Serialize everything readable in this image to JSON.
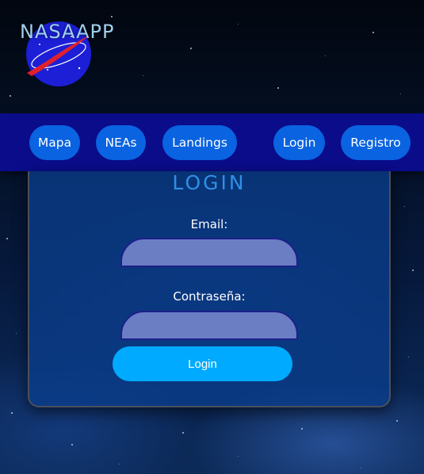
{
  "header": {
    "brand": "NASAAPP",
    "logo_icon": "nasa-meatball-logo"
  },
  "nav": {
    "items": [
      {
        "label": "Mapa"
      },
      {
        "label": "NEAs"
      },
      {
        "label": "Landings"
      },
      {
        "label": "Login"
      },
      {
        "label": "Registro"
      }
    ]
  },
  "login": {
    "title": "LOGIN",
    "email_label": "Email:",
    "email_value": "",
    "password_label": "Contraseña:",
    "password_value": "",
    "submit_label": "Login"
  },
  "colors": {
    "nav_bg": "#0a0c8a",
    "nav_button": "#0a63e0",
    "title": "#2f8fe6",
    "input_bg": "#6b7ec4",
    "submit": "#00aaff"
  }
}
